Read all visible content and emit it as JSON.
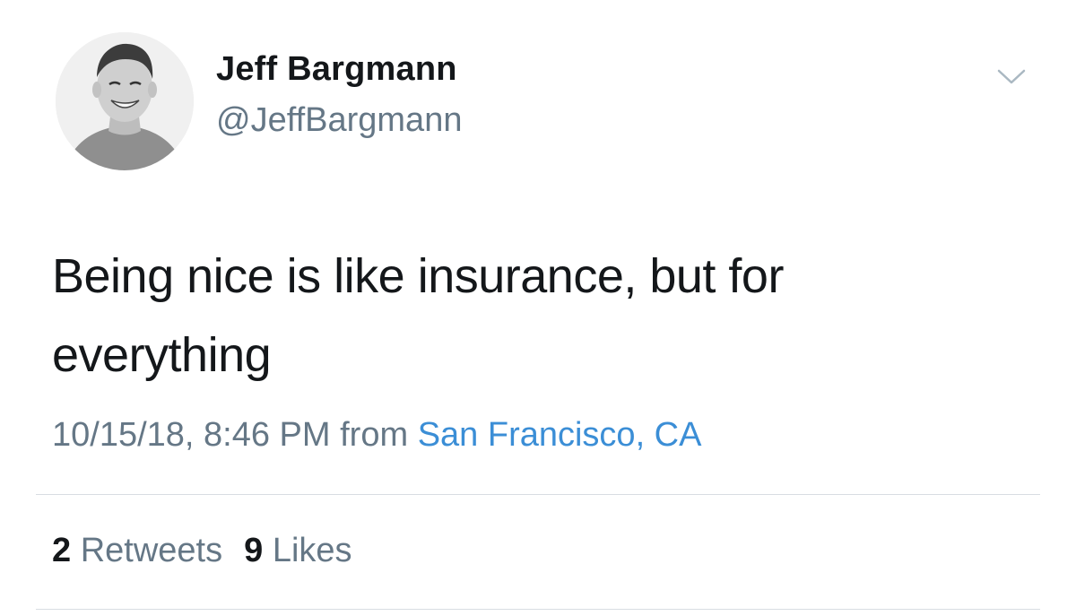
{
  "author": {
    "display_name": "Jeff Bargmann",
    "handle": "@JeffBargmann"
  },
  "tweet": {
    "text": "Being nice is like insurance, but for everything",
    "timestamp": "10/15/18, 8:46 PM",
    "from_label": "from",
    "location": "San Francisco, CA"
  },
  "stats": {
    "retweets_count": "2",
    "retweets_label": "Retweets",
    "likes_count": "9",
    "likes_label": "Likes"
  },
  "icons": {
    "menu": "chevron-down-icon"
  },
  "colors": {
    "text": "#14171a",
    "secondary": "#657786",
    "link": "#3b8ed6",
    "divider": "#d8dde2"
  }
}
